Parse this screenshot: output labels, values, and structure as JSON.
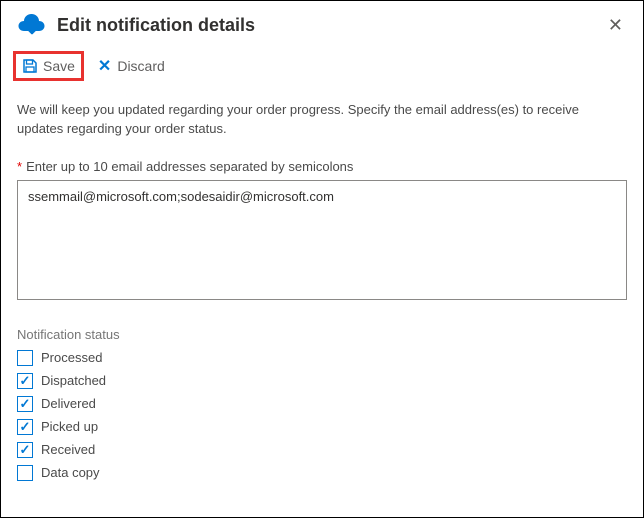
{
  "header": {
    "title": "Edit notification details"
  },
  "toolbar": {
    "save_label": "Save",
    "discard_label": "Discard"
  },
  "description": "We will keep you updated regarding your order progress. Specify the email address(es) to receive updates regarding your order status.",
  "email_field": {
    "label": "Enter up to 10 email addresses separated by semicolons",
    "value": "ssemmail@microsoft.com;sodesaidir@microsoft.com"
  },
  "notification_status": {
    "label": "Notification status",
    "items": [
      {
        "label": "Processed",
        "checked": false
      },
      {
        "label": "Dispatched",
        "checked": true
      },
      {
        "label": "Delivered",
        "checked": true
      },
      {
        "label": "Picked up",
        "checked": true
      },
      {
        "label": "Received",
        "checked": true
      },
      {
        "label": "Data copy",
        "checked": false
      }
    ]
  }
}
